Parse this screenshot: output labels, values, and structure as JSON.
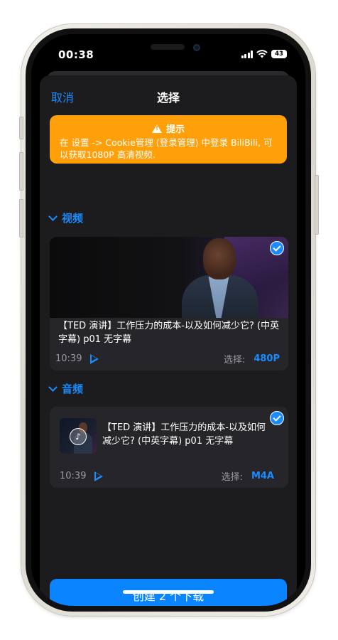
{
  "status_bar": {
    "time": "00:38",
    "battery": "43"
  },
  "nav": {
    "cancel_label": "取消",
    "title": "选择"
  },
  "notice": {
    "title": "提示",
    "body": "在 设置 -> Cookie管理 (登录管理) 中登录 BiliBili, 可以获取1080P 高清视频."
  },
  "video_section": {
    "label": "视频",
    "item": {
      "title": "【TED 演讲】工作压力的成本-以及如何减少它? (中英字幕)  p01 无字幕",
      "duration": "10:39",
      "select_label": "选择:",
      "quality": "480P",
      "selected": true
    }
  },
  "audio_section": {
    "label": "音频",
    "item": {
      "title": "【TED 演讲】工作压力的成本-以及如何减少它? (中英字幕)  p01 无字幕",
      "duration": "10:39",
      "select_label": "选择:",
      "format": "M4A",
      "selected": true
    }
  },
  "create_button": {
    "label": "创建 2 个下载"
  },
  "colors": {
    "accent": "#0a84ff",
    "warning": "#ff9f0a",
    "sheet_bg": "#1c1c1e",
    "card_bg": "#26262a"
  },
  "icons": {
    "warning": "warning-triangle-icon",
    "chevron": "chevron-down-icon",
    "check": "checkmark-circle-icon",
    "play": "play-icon",
    "music": "music-note-icon"
  }
}
